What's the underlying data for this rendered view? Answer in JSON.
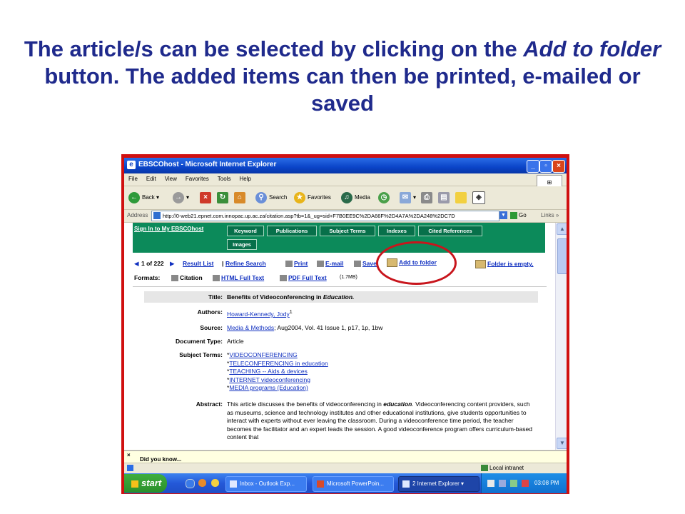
{
  "slide": {
    "heading_part1": "The article/s can be selected by clicking on the ",
    "heading_em1": "Add to folder",
    "heading_part2": " button. The added items can then be printed, e-mailed or saved",
    "annotation_color": "#c8151c"
  },
  "window": {
    "title": "EBSCOhost - Microsoft Internet Explorer",
    "minimize": "_",
    "maximize": "▫",
    "close": "×",
    "menu": [
      "File",
      "Edit",
      "View",
      "Favorites",
      "Tools",
      "Help"
    ],
    "toolbar": {
      "back": "Back",
      "search": "Search",
      "favorites": "Favorites",
      "media": "Media"
    },
    "address": {
      "label": "Address",
      "url": "http://0-web21.epnet.com.innopac.up.ac.za/citation.asp?tb=1&_ug=sid+F7B0EE9C%2DA66F%2D4A7A%2DA248%2DC7D",
      "go": "Go",
      "links": "Links"
    }
  },
  "ebsco": {
    "sign_in": "Sign In to My EBSCOhost",
    "tabs": [
      "Keyword",
      "Publications",
      "Subject Terms",
      "Indexes",
      "Cited References",
      "Images"
    ],
    "result_pos": "1 of 222",
    "result_list": "Result List",
    "refine_search": "Refine Search",
    "print": "Print",
    "email": "E-mail",
    "save": "Save",
    "add_to_folder": "Add to folder",
    "folder_status": "Folder is empty.",
    "formats_label": "Formats:",
    "citation": "Citation",
    "html_full_text": "HTML Full Text",
    "pdf_full_text": "PDF Full Text",
    "pdf_size": "(1.7MB)",
    "record": {
      "title_label": "Title:",
      "title_value_prefix": "Benefits of Videoconferencing in ",
      "title_value_em": "Education.",
      "authors_label": "Authors:",
      "author": "Howard-Kennedy, Jody",
      "author_sup": "1",
      "source_label": "Source:",
      "source_link": "Media & Methods",
      "source_rest": "; Aug2004, Vol. 41 Issue 1, p17, 1p, 1bw",
      "doctype_label": "Document Type:",
      "doctype_value": "Article",
      "subject_label": "Subject Terms:",
      "subjects": [
        "VIDEOCONFERENCING",
        "TELECONFERENCING in education",
        "TEACHING -- Aids & devices",
        "INTERNET videoconferencing",
        "MEDIA programs (Education)"
      ],
      "subject_prefix": "*",
      "abstract_label": "Abstract:",
      "abstract_part1": "This article discusses the benefits of videoconferencing in ",
      "abstract_em": "education",
      "abstract_part2": ". Videoconferencing content providers, such as museums, science and technology institutes and other educational institutions, give students opportunities to interact with experts without ever leaving the classroom. During a videoconference time period, the teacher becomes the facilitator and an expert leads the session. A good videoconference program offers curriculum-based content that"
    }
  },
  "infobar": {
    "close": "×",
    "text": "Did you know..."
  },
  "statusbar": {
    "zone": "Local intranet"
  },
  "taskbar": {
    "start": "start",
    "tasks": [
      "Inbox - Outlook Exp...",
      "Microsoft PowerPoin...",
      "2 Internet Explorer"
    ],
    "clock": "03:08 PM"
  }
}
